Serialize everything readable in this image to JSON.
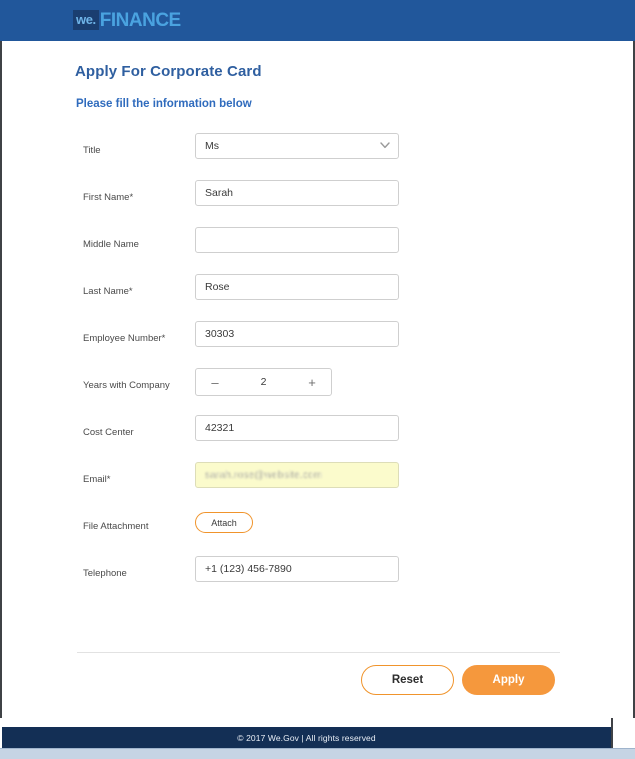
{
  "header": {
    "brand_mark": "we.",
    "brand_word": "FINANCE",
    "background_color": "#21579b",
    "brand_word_color": "#4aa3e0"
  },
  "page": {
    "title": "Apply For Corporate Card",
    "subtitle": "Please fill the information below",
    "title_color": "#2f5fa0"
  },
  "form": {
    "fields": [
      {
        "label": "Title",
        "type": "select",
        "value": "Ms",
        "icon": "chevron-down-icon",
        "name": "title"
      },
      {
        "label": "First Name*",
        "type": "text",
        "value": "Sarah",
        "placeholder": "",
        "name": "first-name"
      },
      {
        "label": "Middle Name",
        "type": "text",
        "value": "",
        "placeholder": "",
        "name": "middle-name"
      },
      {
        "label": "Last Name*",
        "type": "text",
        "value": "Rose",
        "placeholder": "",
        "name": "last-name"
      },
      {
        "label": "Employee Number*",
        "type": "text",
        "value": "30303",
        "placeholder": "",
        "name": "employee-number"
      },
      {
        "label": "Years with Company",
        "type": "stepper",
        "value": "2",
        "decrement_label": "–",
        "increment_label": "+",
        "name": "years-with-company"
      },
      {
        "label": "Cost Center",
        "type": "text",
        "value": "42321",
        "placeholder": "",
        "name": "cost-center"
      },
      {
        "label": "Email*",
        "type": "email-autofilled",
        "value": "sarah.rose@website.com",
        "redacted": true,
        "background_color": "#fbfbcc",
        "name": "email"
      },
      {
        "label": "File Attachment",
        "type": "button",
        "value": "Attach",
        "name": "file-attachment"
      },
      {
        "label": "Telephone",
        "type": "text",
        "value": "+1 (123) 456-7890",
        "placeholder": "+1 (123) 456-7890",
        "name": "telephone"
      }
    ]
  },
  "actions": {
    "reset_label": "Reset",
    "apply_label": "Apply",
    "accent_color": "#f5983d"
  },
  "footer": {
    "text": "© 2017 We.Gov | All rights reserved",
    "background_color": "#132f55"
  }
}
